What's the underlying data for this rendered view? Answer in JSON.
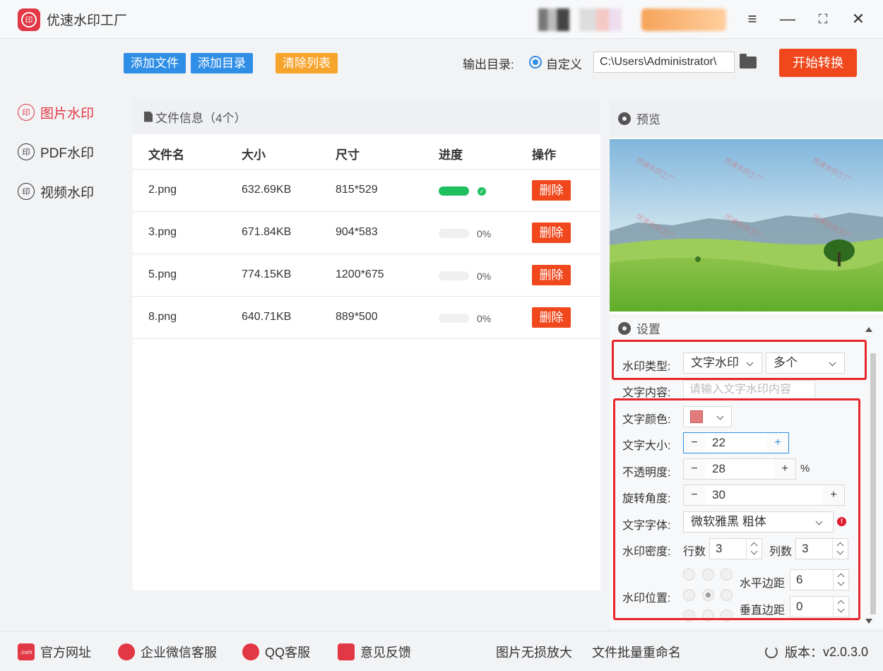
{
  "app": {
    "title": "优速水印工厂",
    "logo_text": "印"
  },
  "window_controls": {
    "menu": "≡",
    "minimize": "—",
    "maximize": "⛶",
    "close": "✕"
  },
  "nav": [
    {
      "label": "图片水印",
      "icon": "印",
      "active": true
    },
    {
      "label": "PDF水印",
      "icon": "印",
      "active": false
    },
    {
      "label": "视频水印",
      "icon": "印",
      "active": false
    }
  ],
  "toolbar": {
    "add_file": "添加文件",
    "add_dir": "添加目录",
    "clear_list": "清除列表",
    "output_label": "输出目录:",
    "radio_label": "自定义",
    "path": "C:\\Users\\Administrator\\",
    "start": "开始转换"
  },
  "files": {
    "header": "文件信息（4个）",
    "columns": {
      "name": "文件名",
      "size": "大小",
      "dims": "尺寸",
      "progress": "进度",
      "action": "操作"
    },
    "rows": [
      {
        "name": "2.png",
        "size": "632.69KB",
        "dims": "815*529",
        "progress": 1.0,
        "pct": "",
        "action": "删除"
      },
      {
        "name": "3.png",
        "size": "671.84KB",
        "dims": "904*583",
        "progress": 0,
        "pct": "0%",
        "action": "删除"
      },
      {
        "name": "5.png",
        "size": "774.15KB",
        "dims": "1200*675",
        "progress": 0,
        "pct": "0%",
        "action": "删除"
      },
      {
        "name": "8.png",
        "size": "640.71KB",
        "dims": "889*500",
        "progress": 0,
        "pct": "0%",
        "action": "删除"
      }
    ]
  },
  "preview": {
    "header": "预览",
    "watermark_text": "优速水印工厂"
  },
  "settings": {
    "header": "设置",
    "wm_type_label": "水印类型:",
    "wm_type": "文字水印",
    "wm_mode": "多个",
    "text_content_label": "文字内容:",
    "text_content_placeholder": "请输入文字水印内容",
    "color_label": "文字颜色:",
    "color": "#e27b7b",
    "size_label": "文字大小:",
    "size": "22",
    "opacity_label": "不透明度:",
    "opacity": "28",
    "opacity_unit": "%",
    "rotation_label": "旋转角度:",
    "rotation": "30",
    "font_label": "文字字体:",
    "font": "微软雅黑 粗体",
    "density_label": "水印密度:",
    "rows_label": "行数",
    "rows": "3",
    "cols_label": "列数",
    "cols": "3",
    "position_label": "水印位置:",
    "h_margin_label": "水平边距",
    "h_margin": "6",
    "v_margin_label": "垂直边距",
    "v_margin": "0",
    "minus": "−",
    "plus": "+"
  },
  "footer": {
    "website": "官方网址",
    "wechat": "企业微信客服",
    "qq": "QQ客服",
    "feedback": "意见反馈",
    "upscale": "图片无损放大",
    "rename": "文件批量重命名",
    "version_label": "版本：",
    "version": "v2.0.3.0"
  }
}
